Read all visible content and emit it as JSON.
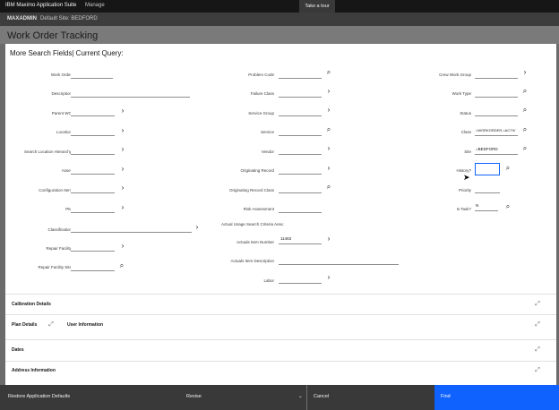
{
  "topbar": {
    "brand": "IBM Maximo Application Suite",
    "manage": "Manage",
    "tour": "Take a tour"
  },
  "sitebar": {
    "app": "MAXADMIN",
    "site": "Default Site: BEDFORD"
  },
  "page": {
    "title": "Work Order Tracking"
  },
  "dialog": {
    "title": "More Search Fields| Current Query:",
    "fields": {
      "work_order": {
        "label": "Work Order",
        "value": ""
      },
      "description": {
        "label": "Description",
        "value": ""
      },
      "parent_wo": {
        "label": "Parent WO",
        "value": ""
      },
      "location": {
        "label": "Location",
        "value": ""
      },
      "search_location_hierarchy": {
        "label": "Search Location Hierarchy",
        "value": ""
      },
      "asset": {
        "label": "Asset",
        "value": ""
      },
      "configuration_item": {
        "label": "Configuration Item",
        "value": ""
      },
      "pm": {
        "label": "PM",
        "value": ""
      },
      "classification": {
        "label": "Classification",
        "value": ""
      },
      "repair_facility": {
        "label": "Repair Facility",
        "value": ""
      },
      "repair_facility_site": {
        "label": "Repair Facility Site",
        "value": ""
      },
      "problem_code": {
        "label": "Problem Code",
        "value": ""
      },
      "failure_class": {
        "label": "Failure Class",
        "value": ""
      },
      "service_group": {
        "label": "Service Group",
        "value": ""
      },
      "service": {
        "label": "Service",
        "value": ""
      },
      "vendor": {
        "label": "Vendor",
        "value": ""
      },
      "originating_record": {
        "label": "Originating Record",
        "value": ""
      },
      "originating_record_class": {
        "label": "Originating Record Class",
        "value": ""
      },
      "risk_assessment": {
        "label": "Risk Assessment",
        "value": ""
      },
      "actual_usage_area": {
        "label": "Actual Usage Search Criteria Area:"
      },
      "actuals_item_number": {
        "label": "Actuals Item Number",
        "value": "11463"
      },
      "actuals_item_description": {
        "label": "Actuals Item Description",
        "value": ""
      },
      "labor": {
        "label": "Labor",
        "value": ""
      },
      "crew_work_group": {
        "label": "Crew Work Group",
        "value": ""
      },
      "work_type": {
        "label": "Work Type",
        "value": ""
      },
      "status": {
        "label": "Status",
        "value": ""
      },
      "class": {
        "label": "Class",
        "value": "=WORKORDER,=ACTIV"
      },
      "site": {
        "label": "Site",
        "value": "=BEDFORD"
      },
      "history": {
        "label": "History?",
        "value": ""
      },
      "priority": {
        "label": "Priority",
        "value": ""
      },
      "is_task": {
        "label": "Is Task?",
        "value": "N"
      }
    },
    "sections": {
      "calibration": "Calibration Details",
      "plan": "Plan Details",
      "user_info": "User Information",
      "dates": "Dates",
      "address": "Address Information"
    }
  },
  "footer": {
    "restore": "Restore Application Defaults",
    "revise": "Revise",
    "cancel": "Cancel",
    "find": "Find"
  },
  "colors": {
    "primary": "#0f62fe",
    "footer": "#393939",
    "topbar": "#161616"
  }
}
